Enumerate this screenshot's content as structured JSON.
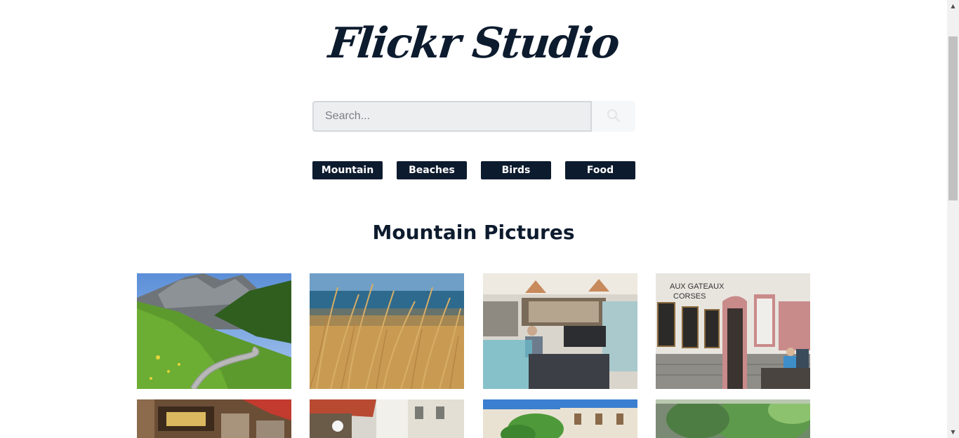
{
  "header": {
    "logo_text": "Flickr Studio"
  },
  "search": {
    "placeholder": "Search...",
    "value": "",
    "button_icon": "search-icon"
  },
  "filters": [
    {
      "label": "Mountain"
    },
    {
      "label": "Beaches"
    },
    {
      "label": "Birds"
    },
    {
      "label": "Food"
    }
  ],
  "gallery": {
    "title": "Mountain Pictures",
    "photos": [
      {
        "subject": "mountain road through green valley"
      },
      {
        "subject": "dry grass in front of blue sea"
      },
      {
        "subject": "pastry shop interior with counter"
      },
      {
        "subject": "Aux Gateaux Corses storefront with cafe seating"
      },
      {
        "subject": "shop front with red awning"
      },
      {
        "subject": "narrow old town street"
      },
      {
        "subject": "building facade behind trees and blue sky"
      },
      {
        "subject": "green trees in courtyard"
      }
    ]
  },
  "colors": {
    "brand_navy": "#0d1b2e",
    "search_bg": "#eceef0",
    "scrollbar_track": "#f1f1f1",
    "scrollbar_thumb": "#c1c1c1"
  }
}
